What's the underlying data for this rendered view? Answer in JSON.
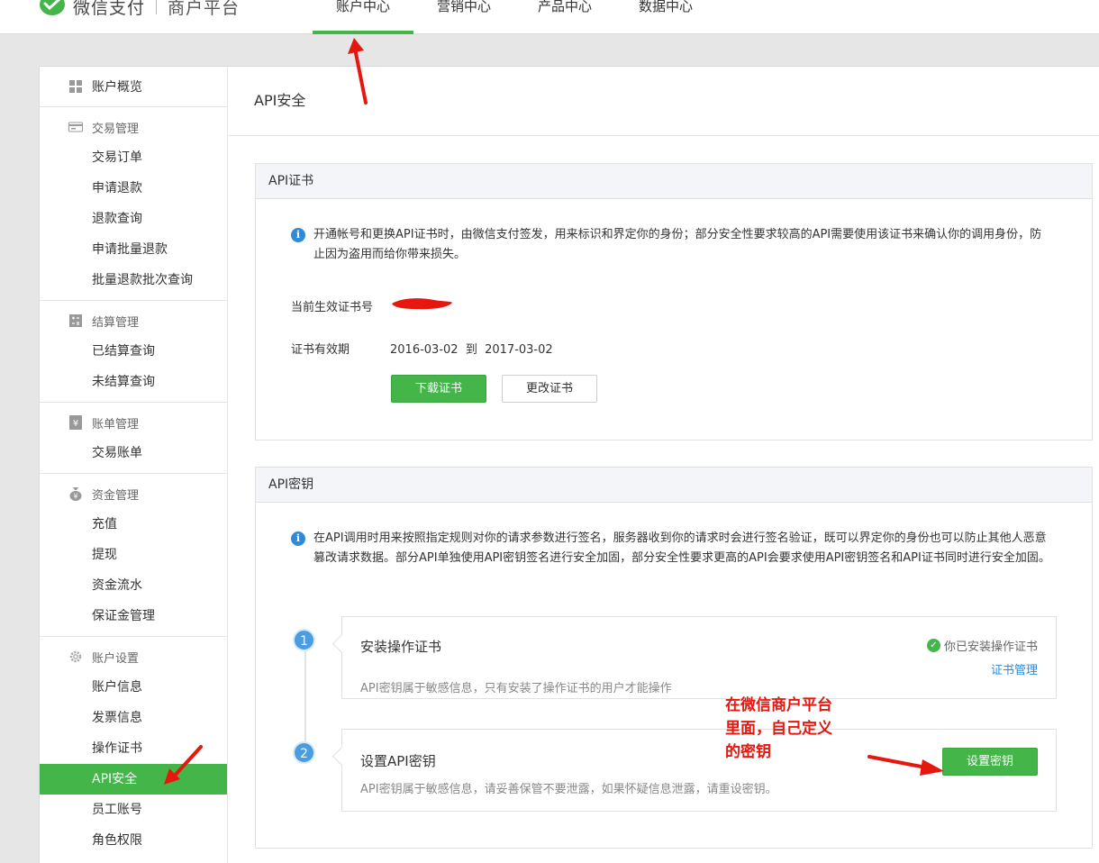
{
  "header": {
    "logo_text": "微信支付",
    "logo_sub": "商户平台",
    "nav": [
      {
        "label": "账户中心",
        "active": true
      },
      {
        "label": "营销中心",
        "active": false
      },
      {
        "label": "产品中心",
        "active": false
      },
      {
        "label": "数据中心",
        "active": false
      }
    ]
  },
  "sidebar": {
    "overview": "账户概览",
    "groups": [
      {
        "title": "交易管理",
        "icon": "transaction-icon",
        "items": [
          "交易订单",
          "申请退款",
          "退款查询",
          "申请批量退款",
          "批量退款批次查询"
        ]
      },
      {
        "title": "结算管理",
        "icon": "calculator-icon",
        "items": [
          "已结算查询",
          "未结算查询"
        ]
      },
      {
        "title": "账单管理",
        "icon": "bill-icon",
        "items": [
          "交易账单"
        ]
      },
      {
        "title": "资金管理",
        "icon": "money-bag-icon",
        "items": [
          "充值",
          "提现",
          "资金流水",
          "保证金管理"
        ]
      },
      {
        "title": "账户设置",
        "icon": "gear-icon",
        "items": [
          "账户信息",
          "发票信息",
          "操作证书",
          "API安全",
          "员工账号",
          "角色权限"
        ]
      }
    ],
    "active_item": "API安全"
  },
  "content": {
    "page_title": "API安全",
    "cert": {
      "heading": "API证书",
      "info": "开通帐号和更换API证书时，由微信支付签发，用来标识和界定你的身份；部分安全性要求较高的API需要使用该证书来确认你的调用身份，防止因为盗用而给你带来损失。",
      "cert_no_label": "当前生效证书号",
      "validity_label": "证书有效期",
      "validity_from": "2016-03-02",
      "validity_to_word": "到",
      "validity_to": "2017-03-02",
      "download_btn": "下载证书",
      "change_btn": "更改证书"
    },
    "key": {
      "heading": "API密钥",
      "info": "在API调用时用来按照指定规则对你的请求参数进行签名，服务器收到你的请求时会进行签名验证，既可以界定你的身份也可以防止其他人恶意篡改请求数据。部分API单独使用API密钥签名进行安全加固，部分安全性要求更高的API会要求使用API密钥签名和API证书同时进行安全加固。",
      "steps": [
        {
          "num": "1",
          "title": "安装操作证书",
          "desc": "API密钥属于敏感信息，只有安装了操作证书的用户才能操作",
          "status": "你已安装操作证书",
          "link": "证书管理"
        },
        {
          "num": "2",
          "title": "设置API密钥",
          "desc": "API密钥属于敏感信息，请妥善保管不要泄露，如果怀疑信息泄露，请重设密钥。",
          "button": "设置密钥"
        }
      ]
    }
  },
  "annotation": {
    "note_lines": [
      "在微信商户平台",
      "里面，自己定义",
      "的密钥"
    ],
    "color": "#e5170e"
  },
  "colors": {
    "brand_green": "#44b549",
    "link_blue": "#2f8ad8"
  }
}
